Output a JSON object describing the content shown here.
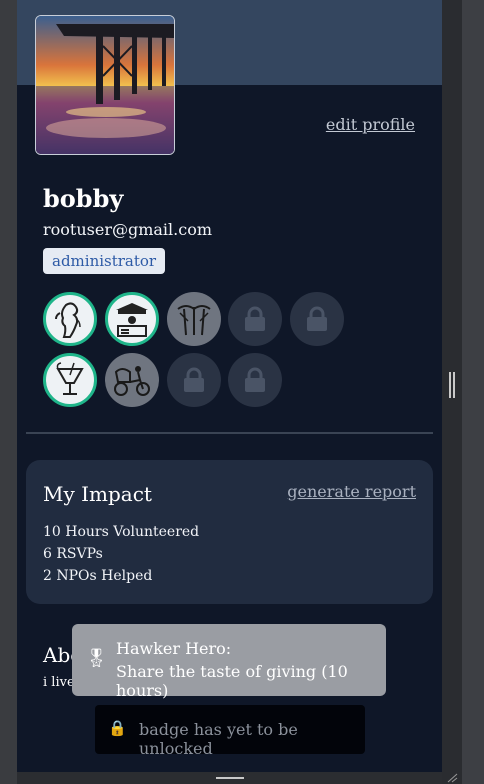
{
  "profile": {
    "edit_label": "edit profile",
    "username": "bobby",
    "email": "rootuser@gmail.com",
    "role": "administrator"
  },
  "badges": [
    {
      "icon": "merlion-icon",
      "state": "unlocked"
    },
    {
      "icon": "hawker-stall-icon",
      "state": "unlocked"
    },
    {
      "icon": "supertree-icon",
      "state": "grey"
    },
    {
      "icon": "lock-icon",
      "state": "locked"
    },
    {
      "icon": "lock-icon",
      "state": "locked"
    },
    {
      "icon": "cocktail-icon",
      "state": "unlocked"
    },
    {
      "icon": "trishaw-icon",
      "state": "grey"
    },
    {
      "icon": "lock-icon",
      "state": "locked"
    },
    {
      "icon": "lock-icon",
      "state": "locked"
    }
  ],
  "impact": {
    "title": "My Impact",
    "report_label": "generate report",
    "stats": [
      "10 Hours Volunteered",
      "6 RSVPs",
      "2 NPOs Helped"
    ]
  },
  "about": {
    "title": "Abo",
    "text": "i live"
  },
  "tooltip": {
    "icon": "medal-icon",
    "title": "Hawker Hero:",
    "description": "Share the taste of giving (10 hours)"
  },
  "toast": {
    "icon": "lock-icon",
    "message": "badge has yet to be unlocked"
  },
  "colors": {
    "panel_bg": "#0f1728",
    "banner": "#34465f",
    "badge_ring": "#1fb58a",
    "card_bg": "#212c40",
    "role_text": "#2d5aa6"
  }
}
